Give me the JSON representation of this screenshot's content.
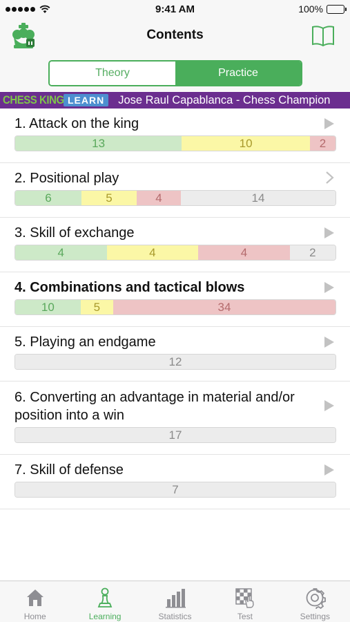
{
  "status_bar": {
    "time": "9:41 AM",
    "battery": "100%"
  },
  "nav": {
    "title": "Contents"
  },
  "segments": {
    "theory": "Theory",
    "practice": "Practice",
    "selected": "Practice"
  },
  "banner": {
    "brand": "CHESS KING",
    "badge": "LEARN",
    "title": "Jose Raul Capablanca - Chess Champion"
  },
  "items": [
    {
      "title": "1. Attack on the king",
      "bold": false,
      "indicator": "arrow",
      "segments": [
        {
          "value": "13",
          "color": "green"
        },
        {
          "value": "10",
          "color": "yellow"
        },
        {
          "value": "2",
          "color": "red"
        }
      ]
    },
    {
      "title": "2. Positional play",
      "bold": false,
      "indicator": "chevron",
      "segments": [
        {
          "value": "6",
          "color": "green"
        },
        {
          "value": "5",
          "color": "yellow"
        },
        {
          "value": "4",
          "color": "red"
        },
        {
          "value": "14",
          "color": "gray"
        }
      ]
    },
    {
      "title": "3. Skill of exchange",
      "bold": false,
      "indicator": "arrow",
      "segments": [
        {
          "value": "4",
          "color": "green"
        },
        {
          "value": "4",
          "color": "yellow"
        },
        {
          "value": "4",
          "color": "red"
        },
        {
          "value": "2",
          "color": "gray"
        }
      ]
    },
    {
      "title": "4. Combinations and tactical blows",
      "bold": true,
      "indicator": "arrow",
      "segments": [
        {
          "value": "10",
          "color": "green"
        },
        {
          "value": "5",
          "color": "yellow"
        },
        {
          "value": "34",
          "color": "red"
        }
      ]
    },
    {
      "title": "5. Playing an endgame",
      "bold": false,
      "indicator": "arrow",
      "segments": [
        {
          "value": "12",
          "color": "gray"
        }
      ]
    },
    {
      "title": "6. Converting an advantage in material and/or position into a win",
      "bold": false,
      "indicator": "arrow",
      "segments": [
        {
          "value": "17",
          "color": "gray"
        }
      ]
    },
    {
      "title": "7. Skill of defense",
      "bold": false,
      "indicator": "arrow",
      "segments": [
        {
          "value": "7",
          "color": "gray"
        }
      ]
    }
  ],
  "tabs": [
    {
      "label": "Home",
      "icon": "home-icon",
      "active": false
    },
    {
      "label": "Learning",
      "icon": "pawn-icon",
      "active": true
    },
    {
      "label": "Statistics",
      "icon": "bar-chart-icon",
      "active": false
    },
    {
      "label": "Test",
      "icon": "chessboard-hand-icon",
      "active": false
    },
    {
      "label": "Settings",
      "icon": "gear-icon",
      "active": false
    }
  ],
  "colors": {
    "accent": "#4aae5b",
    "banner": "#6b2e8f",
    "green": "#cde9c8",
    "yellow": "#fbf7a6",
    "red": "#eec4c5",
    "gray": "#ececec"
  }
}
